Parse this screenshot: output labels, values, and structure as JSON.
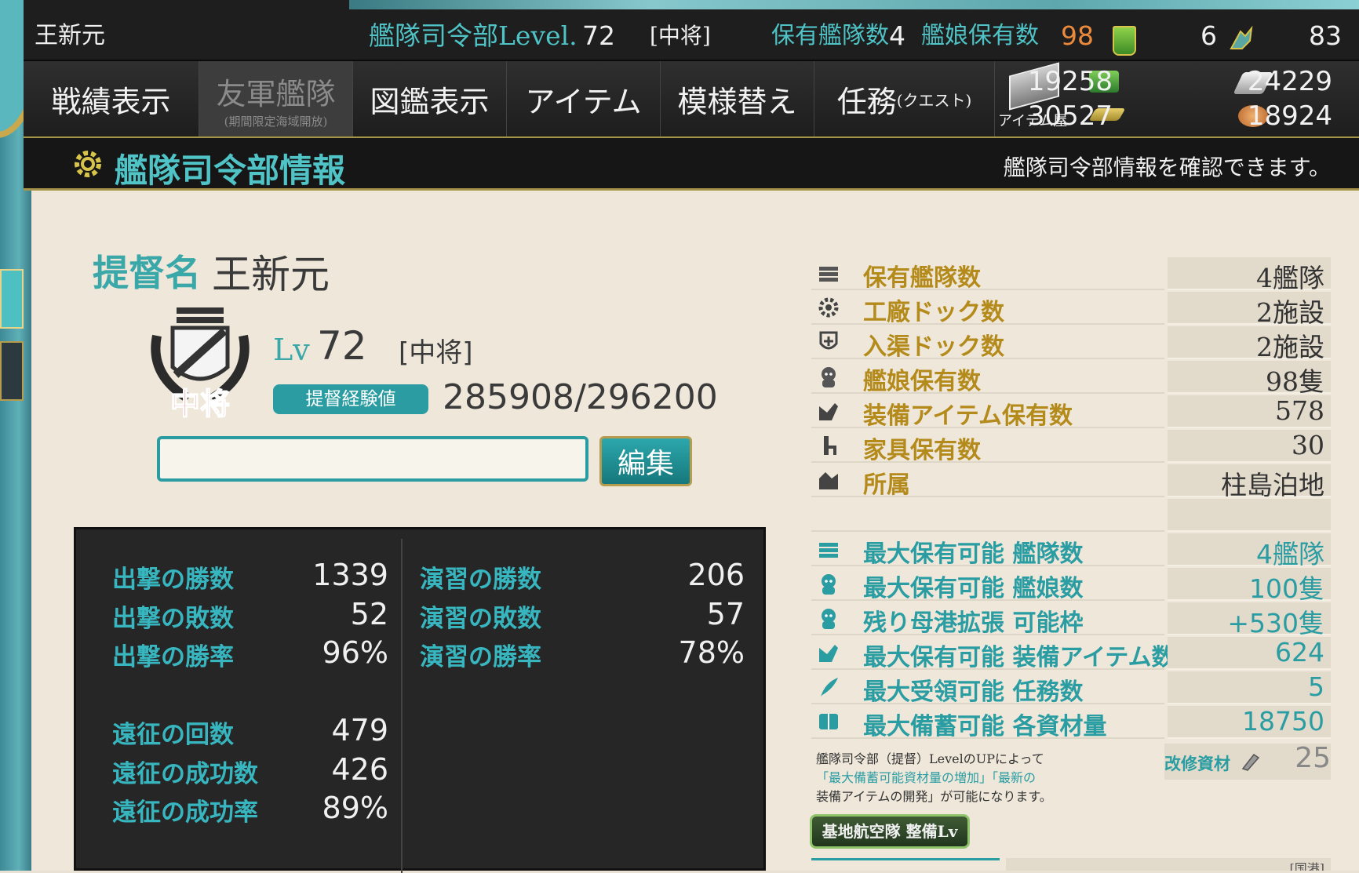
{
  "top_bar": {
    "player_name": "王新元",
    "hq_level_label": "艦隊司令部Level.",
    "hq_level": "72",
    "rank": "[中将]",
    "fleet_count_label": "保有艦隊数",
    "fleet_count": "4",
    "ship_count_label": "艦娘保有数",
    "ship_count": "98",
    "dev_material": "6",
    "extra_count": "83"
  },
  "nav": {
    "items": [
      {
        "label": "戦績表示",
        "sub": ""
      },
      {
        "label": "友軍艦隊",
        "sub": "(期間限定海域開放)"
      },
      {
        "label": "図鑑表示",
        "sub": ""
      },
      {
        "label": "アイテム",
        "sub": ""
      },
      {
        "label": "模様替え",
        "sub": ""
      },
      {
        "label": "任務",
        "sub": "(クエスト)"
      }
    ],
    "shop_label": "アイテム屋"
  },
  "resources": {
    "fuel": "19258",
    "ammo": "24229",
    "steel": "30527",
    "bauxite": "18924"
  },
  "title_bar": {
    "title": "艦隊司令部情報",
    "description": "艦隊司令部情報を確認できます。"
  },
  "profile": {
    "admiral_label": "提督名",
    "admiral_name": "王新元",
    "lv_label": "Lv",
    "level": "72",
    "rank": "[中将]",
    "rank_emblem_text": "中将",
    "exp_label": "提督経験値",
    "exp_value": "285908/296200",
    "comment_value": "",
    "edit_label": "編集"
  },
  "battle_stats": {
    "sortie_wins_label": "出撃の勝数",
    "sortie_wins": "1339",
    "sortie_losses_label": "出撃の敗数",
    "sortie_losses": "52",
    "sortie_rate_label": "出撃の勝率",
    "sortie_rate": "96%",
    "exercise_wins_label": "演習の勝数",
    "exercise_wins": "206",
    "exercise_losses_label": "演習の敗数",
    "exercise_losses": "57",
    "exercise_rate_label": "演習の勝率",
    "exercise_rate": "78%",
    "expedition_count_label": "遠征の回数",
    "expedition_count": "479",
    "expedition_success_label": "遠征の成功数",
    "expedition_success": "426",
    "expedition_rate_label": "遠征の成功率",
    "expedition_rate": "89%"
  },
  "info_table": {
    "rows": [
      {
        "icon": "fleet-icon",
        "label": "保有艦隊数",
        "value": "4艦隊"
      },
      {
        "icon": "gear-icon",
        "label": "工廠ドック数",
        "value": "2施設"
      },
      {
        "icon": "repair-cross-icon",
        "label": "入渠ドック数",
        "value": "2施設"
      },
      {
        "icon": "shipgirl-icon",
        "label": "艦娘保有数",
        "value": "98隻"
      },
      {
        "icon": "equipment-icon",
        "label": "装備アイテム保有数",
        "value": "578"
      },
      {
        "icon": "chair-icon",
        "label": "家具保有数",
        "value": "30"
      },
      {
        "icon": "base-icon",
        "label": "所属",
        "value": "柱島泊地"
      }
    ],
    "max_rows": [
      {
        "icon": "fleet-icon",
        "label": "最大保有可能 艦隊数",
        "value": "4艦隊"
      },
      {
        "icon": "shipgirl-icon",
        "label": "最大保有可能 艦娘数",
        "value": "100隻"
      },
      {
        "icon": "shipgirl-icon",
        "label": "残り母港拡張 可能枠",
        "value": "+530隻"
      },
      {
        "icon": "equipment-icon",
        "label": "最大保有可能 装備アイテム数",
        "value": "624"
      },
      {
        "icon": "quill-icon",
        "label": "最大受領可能 任務数",
        "value": "5"
      },
      {
        "icon": "book-icon",
        "label": "最大備蓄可能 各資材量",
        "value": "18750"
      }
    ]
  },
  "note": {
    "line1": "艦隊司令部（提督）LevelのUPによって",
    "line2": "「最大備蓄可能資材量の増加」「最新の",
    "line3": "装備アイテムの開発」が可能になります。"
  },
  "improvement": {
    "label": "改修資材",
    "value": "25"
  },
  "lbas_button_label": "基地航空隊 整備Lv",
  "bottom_strip_text": "[国港]",
  "colors": {
    "accent_teal": "#4fc3c6",
    "label_teal": "#38b6c0",
    "gold_label": "#b48a1a",
    "orange": "#ec8a3c"
  }
}
